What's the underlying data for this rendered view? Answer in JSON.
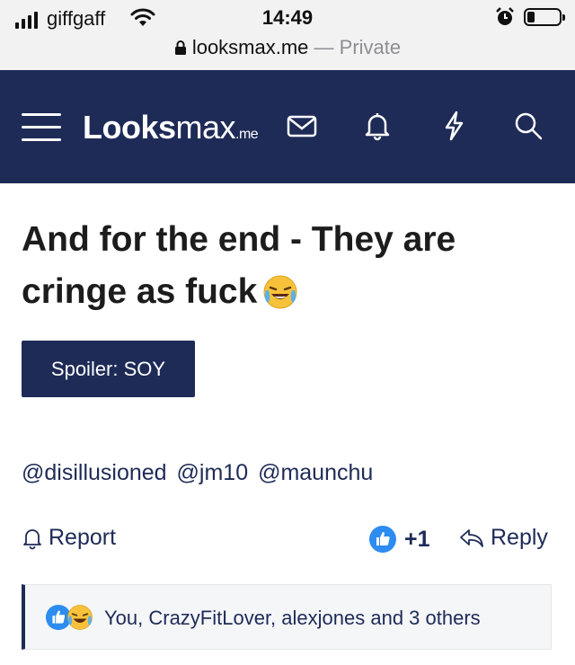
{
  "statusbar": {
    "carrier": "giffgaff",
    "time": "14:49",
    "url": "looksmax.me",
    "separator": "—",
    "private_label": "Private"
  },
  "site": {
    "logo_bold": "Looks",
    "logo_light": "max",
    "logo_tld": ".me",
    "header_color": "#1e2b57"
  },
  "post": {
    "title": "And for the end - They are cringe as fuck",
    "title_emoji": "face-with-tears-of-joy",
    "spoiler_label": "Spoiler: SOY",
    "mentions": [
      "@disillusioned",
      "@jm10",
      "@maunchu"
    ]
  },
  "actions": {
    "report_label": "Report",
    "like_count": "+1",
    "reply_label": "Reply"
  },
  "reactions": {
    "text": "You, CrazyFitLover, alexjones and 3 others",
    "icons": [
      "like-icon",
      "laugh-emoji-icon"
    ]
  }
}
